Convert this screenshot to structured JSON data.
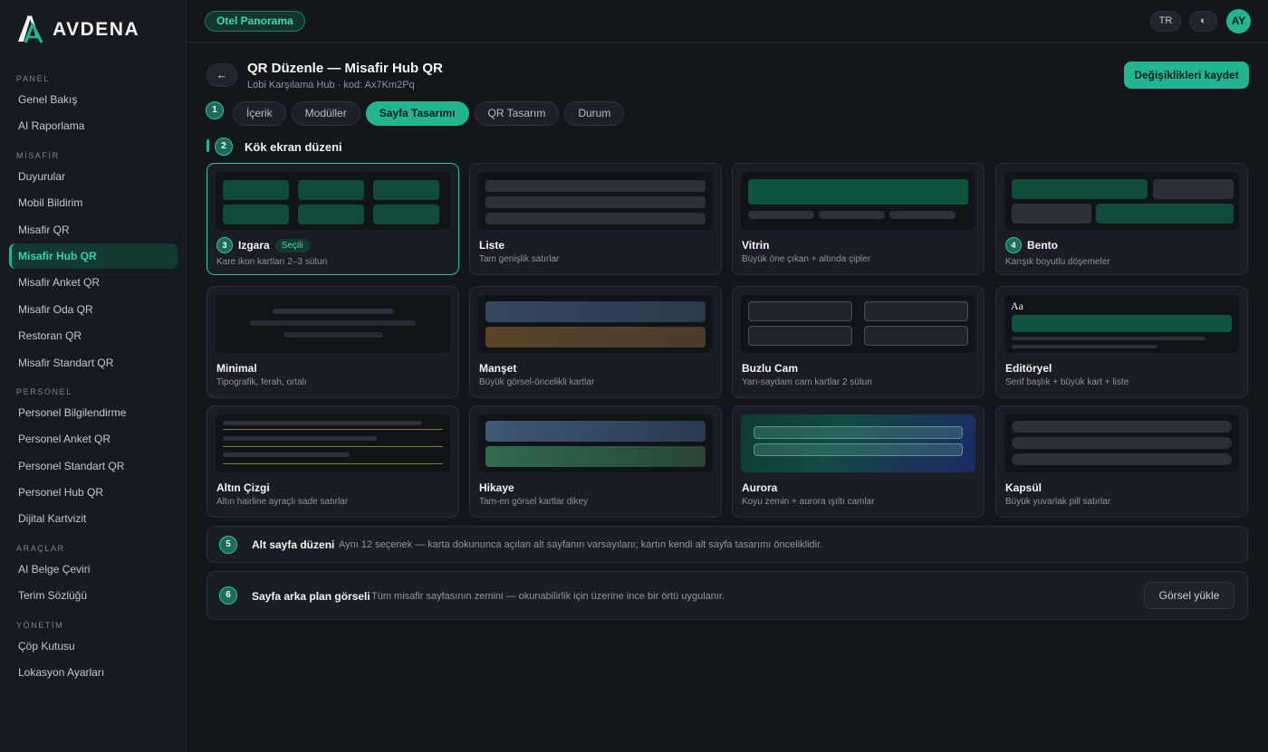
{
  "brand": {
    "name": "AVDENA"
  },
  "sidebar": {
    "sections": [
      {
        "title": "PANEL",
        "items": [
          "Genel Bakış",
          "AI Raporlama"
        ]
      },
      {
        "title": "MİSAFİR",
        "items": [
          "Duyurular",
          "Mobil Bildirim",
          "Misafir QR",
          "Misafir Hub QR",
          "Misafir Anket QR",
          "Misafir Oda QR",
          "Restoran QR",
          "Misafir Standart QR"
        ]
      },
      {
        "title": "PERSONEL",
        "items": [
          "Personel Bilgilendirme",
          "Personel Anket QR",
          "Personel Standart QR",
          "Personel Hub QR",
          "Dijital Kartvizit"
        ]
      },
      {
        "title": "ARAÇLAR",
        "items": [
          "AI Belge Çeviri",
          "Terim Sözlüğü"
        ]
      },
      {
        "title": "YÖNETİM",
        "items": [
          "Çöp Kutusu",
          "Lokasyon Ayarları"
        ]
      }
    ],
    "active_item": "Misafir Hub QR"
  },
  "topbar": {
    "hotel": "Otel Panorama",
    "lang": "TR",
    "theme_icon": "◐",
    "avatar": "AY"
  },
  "header": {
    "back": "←",
    "title": "QR Düzenle — Misafir Hub QR",
    "subtitle": "Lobi Karşılama Hub · kod: Ax7Km2Pq",
    "save": "Değişiklikleri kaydet"
  },
  "steps": [
    "1",
    "2",
    "3",
    "4",
    "5",
    "6"
  ],
  "tabs": [
    "İçerik",
    "Modüller",
    "Sayfa Tasarımı",
    "QR Tasarım",
    "Durum"
  ],
  "active_tab": "Sayfa Tasarımı",
  "section": {
    "title": "Kök ekran düzeni"
  },
  "layouts": [
    {
      "id": "izgara",
      "title": "Izgara",
      "desc": "Kare ikon kartları 2–3 sütun",
      "badge": "Seçili",
      "selected": true
    },
    {
      "id": "liste",
      "title": "Liste",
      "desc": "Tam genişlik satırlar"
    },
    {
      "id": "vitrin",
      "title": "Vitrin",
      "desc": "Büyük öne çıkan + altında çipler"
    },
    {
      "id": "bento",
      "title": "Bento",
      "desc": "Karışık boyutlu döşemeler"
    },
    {
      "id": "minimal",
      "title": "Minimal",
      "desc": "Tipografik, ferah, ortalı"
    },
    {
      "id": "manset",
      "title": "Manşet",
      "desc": "Büyük görsel-öncelikli kartlar"
    },
    {
      "id": "buzlu",
      "title": "Buzlu Cam",
      "desc": "Yarı-saydam cam kartlar 2 sütun"
    },
    {
      "id": "editoryel",
      "title": "Editöryel",
      "desc": "Serif başlık + büyük kart + liste",
      "preview_text": "Aa"
    },
    {
      "id": "altin",
      "title": "Altın Çizgi",
      "desc": "Altın hairline ayraçlı sade satırlar"
    },
    {
      "id": "hikaye",
      "title": "Hikaye",
      "desc": "Tam-en görsel kartlar dikey"
    },
    {
      "id": "aurora",
      "title": "Aurora",
      "desc": "Koyu zemin + aurora ışıltı camlar"
    },
    {
      "id": "kapsul",
      "title": "Kapsül",
      "desc": "Büyük yuvarlak pill satırlar"
    }
  ],
  "subpage": {
    "title": "Alt sayfa düzeni",
    "desc": "Aynı 12 seçenek — karta dokununca açılan alt sayfanın varsayılanı; kartın kendi alt sayfa tasarımı önceliklidir."
  },
  "background": {
    "title": "Sayfa arka plan görseli",
    "desc": "Tüm misafir sayfasının zemini — okunabilirlik için üzerine ince bir örtü uygulanır.",
    "button": "Görsel yükle"
  },
  "colors": {
    "accent": "#22b58f",
    "bg": "#13161b",
    "gold": "#c9a93e"
  }
}
